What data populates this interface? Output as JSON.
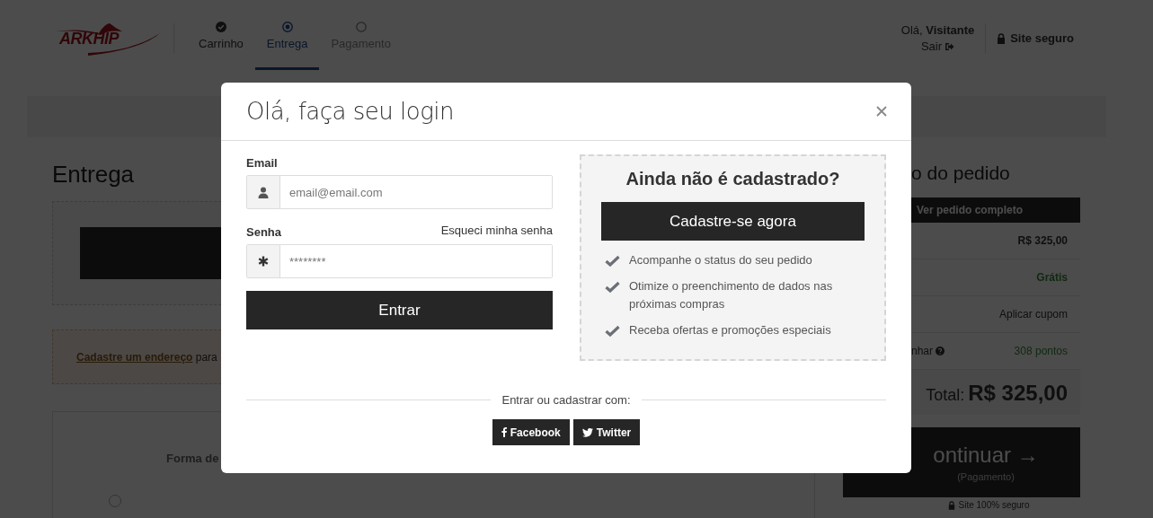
{
  "logo": {
    "text": "ARKHIP"
  },
  "steps": [
    {
      "label": "Carrinho",
      "completed": true,
      "selected": false
    },
    {
      "label": "Entrega",
      "completed": false,
      "selected": true
    },
    {
      "label": "Pagamento",
      "completed": false,
      "selected": false
    }
  ],
  "user": {
    "greeting": "Olá,",
    "name": "Visitante",
    "logout": "Sair"
  },
  "secure_badge": "Site seguro",
  "page_title": "Entrega",
  "address_alert": {
    "link": "Cadastre um endereço",
    "text": "para"
  },
  "shipping": {
    "title": "Forma de",
    "option_selected": false
  },
  "summary": {
    "title": "o do pedido",
    "view_button": "Ver pedido completo",
    "rows": [
      {
        "kind": "price",
        "label": "",
        "value": "R$ 325,00"
      },
      {
        "kind": "free",
        "label": "",
        "value": "Grátis"
      },
      {
        "kind": "link",
        "label": "",
        "value": "Aplicar cupom"
      },
      {
        "kind": "points",
        "label": "nhar",
        "value": "308 pontos"
      }
    ],
    "total_label": "Total:",
    "total_value": "R$ 325,00",
    "continue_button": {
      "label": "ontinuar →",
      "sublabel": "(Pagamento)"
    },
    "secure_note": "Site 100% seguro"
  },
  "login_modal": {
    "title": "Olá, faça seu login",
    "email": {
      "label": "Email",
      "placeholder": "email@email.com"
    },
    "password": {
      "label": "Senha",
      "placeholder": "********",
      "forgot_link": "Esqueci minha senha"
    },
    "submit_button": "Entrar",
    "register": {
      "title": "Ainda não é cadastrado?",
      "button": "Cadastre-se agora",
      "benefits": [
        "Acompanhe o status do seu pedido",
        "Otimize o preenchimento de dados nas próximas compras",
        "Receba ofertas e promoções especiais"
      ]
    },
    "social": {
      "caption": "Entrar ou cadastrar com:",
      "buttons": [
        {
          "kind": "facebook",
          "label": "Facebook"
        },
        {
          "kind": "twitter",
          "label": "Twitter"
        }
      ]
    }
  }
}
